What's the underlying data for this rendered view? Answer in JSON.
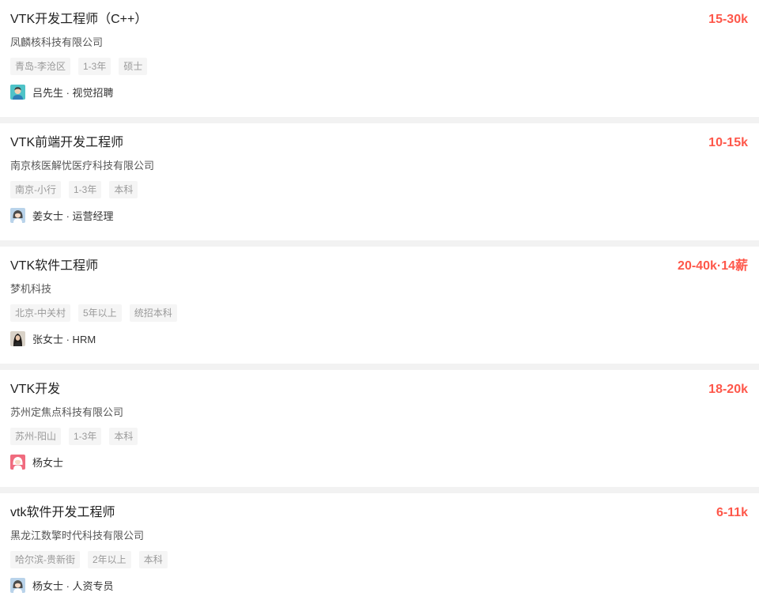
{
  "jobs": [
    {
      "title": "VTK开发工程师（C++）",
      "salary": "15-30k",
      "company": "凤麟核科技有限公司",
      "tags": [
        "青岛-李沧区",
        "1-3年",
        "硕士"
      ],
      "recruiter": "吕先生 · 视觉招聘",
      "avatar_icon": "male-avatar-icon",
      "avatar_bg": "#4fc3c8",
      "avatar_hair": "#3a3a3a",
      "avatar_shirt": "#2e7fb8"
    },
    {
      "title": "VTK前端开发工程师",
      "salary": "10-15k",
      "company": "南京核医解忧医疗科技有限公司",
      "tags": [
        "南京-小行",
        "1-3年",
        "本科"
      ],
      "recruiter": "姜女士 · 运营经理",
      "avatar_icon": "female-avatar-icon",
      "avatar_bg": "#b9d3ea",
      "avatar_hair": "#4a4a4a",
      "avatar_shirt": "#ffffff"
    },
    {
      "title": "VTK软件工程师",
      "salary": "20-40k·14薪",
      "company": "梦机科技",
      "tags": [
        "北京-中关村",
        "5年以上",
        "统招本科"
      ],
      "recruiter": "张女士 · HRM",
      "avatar_icon": "photo-avatar-icon",
      "avatar_bg": "#d9d2c8",
      "avatar_hair": "#1e1a18",
      "avatar_shirt": "#2a2a2a"
    },
    {
      "title": "VTK开发",
      "salary": "18-20k",
      "company": "苏州定焦点科技有限公司",
      "tags": [
        "苏州-阳山",
        "1-3年",
        "本科"
      ],
      "recruiter": "杨女士",
      "avatar_icon": "female-avatar-icon",
      "avatar_bg": "#f06b7e",
      "avatar_hair": "#ffffff",
      "avatar_shirt": "#ffffff"
    },
    {
      "title": "vtk软件开发工程师",
      "salary": "6-11k",
      "company": "黑龙江数擎时代科技有限公司",
      "tags": [
        "哈尔滨-贵新街",
        "2年以上",
        "本科"
      ],
      "recruiter": "杨女士 · 人资专员",
      "avatar_icon": "female-avatar-icon",
      "avatar_bg": "#b9d3ea",
      "avatar_hair": "#4a4a4a",
      "avatar_shirt": "#ffffff"
    }
  ]
}
